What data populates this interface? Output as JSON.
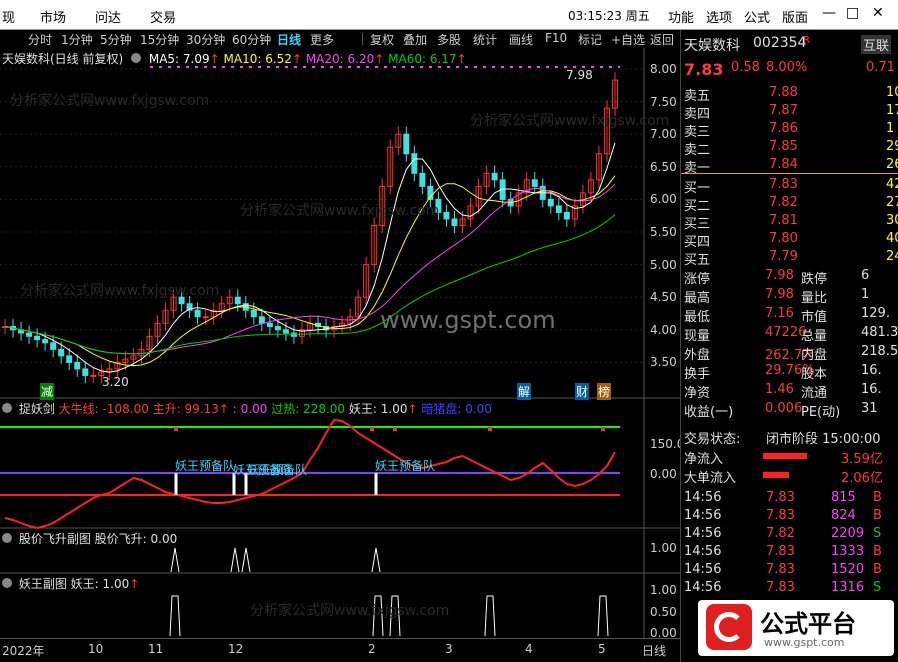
{
  "menu": {
    "items": [
      "现",
      "市场",
      "问达",
      "交易"
    ],
    "clock": "03:15:23 周五",
    "right": [
      "功能",
      "选项",
      "公式",
      "版面"
    ]
  },
  "toolbar": {
    "periods": [
      "分时",
      "1分钟",
      "5分钟",
      "15分钟",
      "30分钟",
      "60分钟",
      "日线",
      "更多"
    ],
    "active": "日线",
    "tools": [
      "复权",
      "叠加",
      "多股",
      "统计",
      "画线",
      "F10",
      "标记",
      "+自选",
      "返回"
    ]
  },
  "stock": {
    "name": "天娱数科",
    "code": "002354",
    "flag": "R",
    "tag": "互联",
    "tag_val": "0.71",
    "price": "7.83",
    "change": "0.58",
    "pct": "8.00%"
  },
  "chart": {
    "title": "天娱数科(日线 前复权)",
    "ma": [
      {
        "label": "MA5: 7.09",
        "color": "#ffffff"
      },
      {
        "label": "MA10: 6.52",
        "color": "#ffff00"
      },
      {
        "label": "MA20: 6.20",
        "color": "#ff40ff"
      },
      {
        "label": "MA60: 6.17",
        "color": "#00d000"
      }
    ],
    "y_ticks": [
      "8.00",
      "7.50",
      "7.00",
      "6.50",
      "6.00",
      "5.50",
      "5.00",
      "4.50",
      "4.00",
      "3.50"
    ],
    "high_label": "7.98",
    "low_label": "3.20",
    "markers": [
      "减",
      "解",
      "财",
      "榜"
    ]
  },
  "panel1": {
    "title": "捉妖剑",
    "items": [
      {
        "t": "大牛线: -108.00",
        "c": "#ff3a3a"
      },
      {
        "t": "主升: 99.13",
        "c": "#ff3a3a"
      },
      {
        "t": ": 0.00",
        "c": "#ff40ff"
      },
      {
        "t": "过热: 228.00",
        "c": "#00d000"
      },
      {
        "t": "妖王: 1.00",
        "c": "#e0e0e0"
      },
      {
        "t": "暗猪盘: 0.00",
        "c": "#4040ff"
      }
    ],
    "y": [
      "150.0",
      "0.00"
    ],
    "labels": [
      "妖王预备队",
      "妖王预备队",
      "妖王预备队",
      "妖王预备队"
    ]
  },
  "panel2": {
    "title": "股价飞升副图",
    "item": "股价飞升: 0.00",
    "y": [
      "1.00"
    ]
  },
  "panel3": {
    "title": "妖王副图",
    "item": "妖王: 1.00",
    "y": [
      "1.00",
      "0.50",
      "0.00"
    ]
  },
  "xaxis": {
    "labels": [
      "2022年",
      "10",
      "11",
      "12",
      "2",
      "3",
      "4",
      "5"
    ],
    "mode": "日线"
  },
  "orderbook": {
    "asks": [
      {
        "l": "卖五",
        "p": "7.88",
        "v": "10"
      },
      {
        "l": "卖四",
        "p": "7.87",
        "v": "17"
      },
      {
        "l": "卖三",
        "p": "7.86",
        "v": "1"
      },
      {
        "l": "卖二",
        "p": "7.85",
        "v": "29"
      },
      {
        "l": "卖一",
        "p": "7.84",
        "v": "26"
      }
    ],
    "bids": [
      {
        "l": "买一",
        "p": "7.83",
        "v": "42"
      },
      {
        "l": "买二",
        "p": "7.82",
        "v": "27"
      },
      {
        "l": "买三",
        "p": "7.81",
        "v": "30"
      },
      {
        "l": "买四",
        "p": "7.80",
        "v": "40"
      },
      {
        "l": "买五",
        "p": "7.79",
        "v": "24"
      }
    ]
  },
  "stats": [
    {
      "a": "涨停",
      "b": "7.98",
      "c": "跌停",
      "d": "6"
    },
    {
      "a": "最高",
      "b": "7.98",
      "c": "量比",
      "d": "1"
    },
    {
      "a": "最低",
      "b": "7.16",
      "c": "市值",
      "d": "129."
    },
    {
      "a": "现量",
      "b": "47226",
      "c": "总量",
      "d": "481.3"
    },
    {
      "a": "外盘",
      "b": "262.7万",
      "c": "内盘",
      "d": "218.5"
    },
    {
      "a": "换手",
      "b": "29.76%",
      "c": "股本",
      "d": "16."
    },
    {
      "a": "净资",
      "b": "1.46",
      "c": "流通",
      "d": "16."
    },
    {
      "a": "收益(一)",
      "b": "0.006",
      "c": "PE(动)",
      "d": "31"
    }
  ],
  "state": {
    "label": "交易状态:",
    "value": "闭市阶段 15:00:00",
    "net_in": "净流入",
    "net_in_v": "3.59亿",
    "big_in": "大单流入",
    "big_in_v": "2.06亿"
  },
  "ticks": [
    {
      "t": "14:56",
      "p": "7.83",
      "v": "815",
      "s": "B"
    },
    {
      "t": "14:56",
      "p": "7.83",
      "v": "824",
      "s": "B"
    },
    {
      "t": "14:56",
      "p": "7.82",
      "v": "2209",
      "s": "S"
    },
    {
      "t": "14:56",
      "p": "7.83",
      "v": "1333",
      "s": "B"
    },
    {
      "t": "14:56",
      "p": "7.83",
      "v": "1520",
      "s": "B"
    },
    {
      "t": "14:56",
      "p": "7.83",
      "v": "1316",
      "s": "S"
    }
  ],
  "watermark": {
    "url": "www.gspt.com",
    "site": "分析家公式网www.fxjgsw.com",
    "logo": "公式平台",
    "logo_url": "www.gspt.com"
  }
}
